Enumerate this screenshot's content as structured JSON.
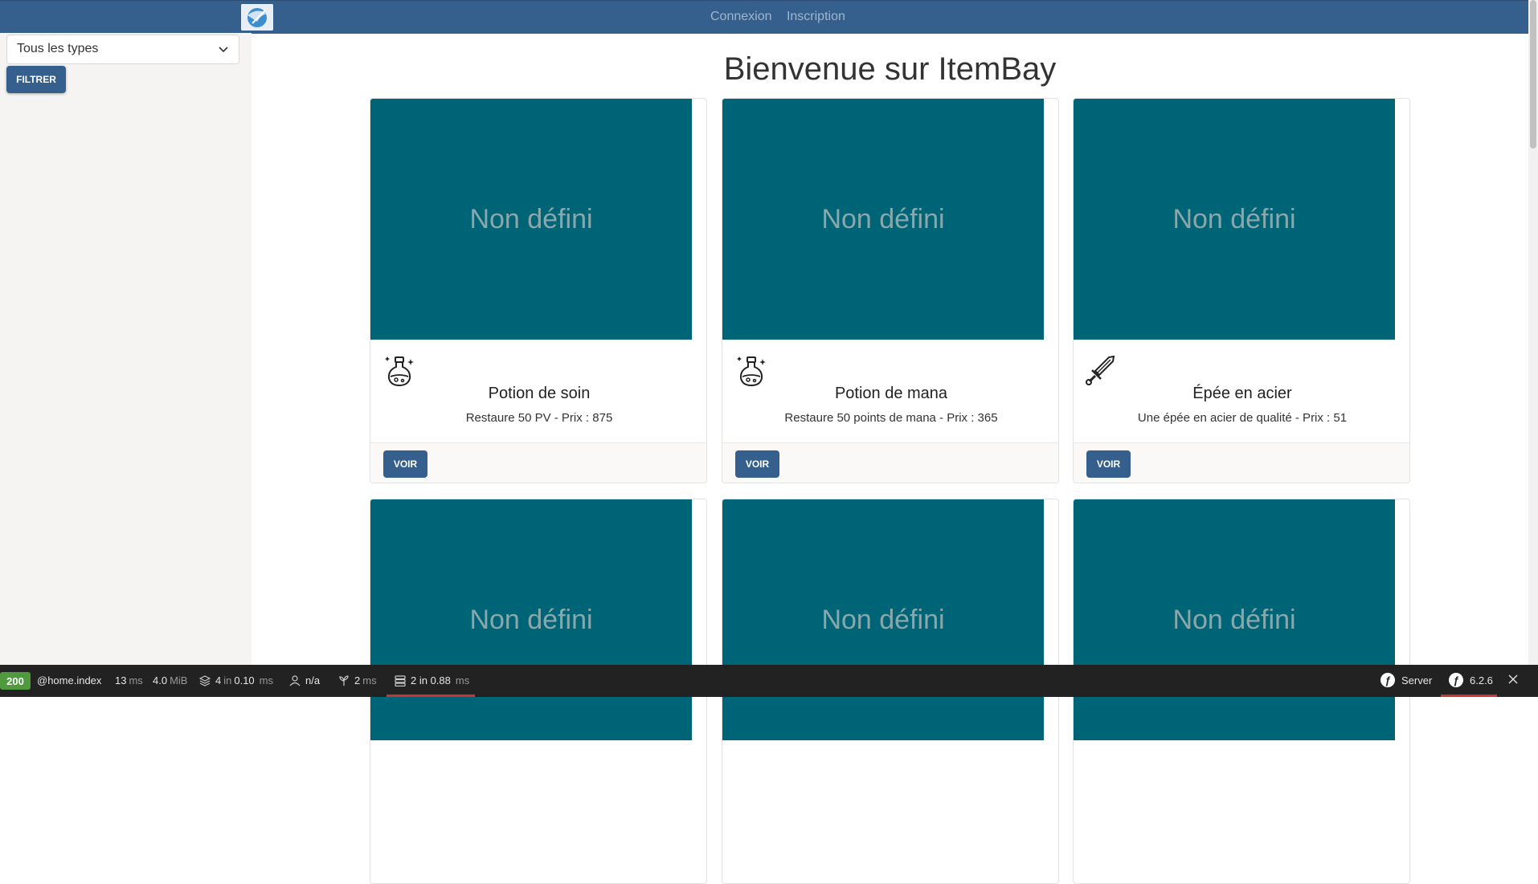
{
  "navbar": {
    "links": [
      "Connexion",
      "Inscription"
    ]
  },
  "sidebar": {
    "type_select": "Tous les types",
    "filter_label": "FILTRER"
  },
  "main": {
    "title": "Bienvenue sur ItemBay",
    "cards": [
      {
        "image_text": "Non défini",
        "icon": "potion-icon",
        "name": "Potion de soin",
        "desc": "Restaure 50 PV - Prix : 875",
        "button": "VOIR"
      },
      {
        "image_text": "Non défini",
        "icon": "potion-icon",
        "name": "Potion de mana",
        "desc": "Restaure 50 points de mana - Prix : 365",
        "button": "VOIR"
      },
      {
        "image_text": "Non défini",
        "icon": "sword-icon",
        "name": "Épée en acier",
        "desc": "Une épée en acier de qualité - Prix : 51",
        "button": "VOIR"
      },
      {
        "image_text": "Non défini"
      },
      {
        "image_text": "Non défini"
      },
      {
        "image_text": "Non défini"
      }
    ]
  },
  "toolbar": {
    "status": "200",
    "route": "@home.index",
    "time_value": "13",
    "time_unit": "ms",
    "memory_value": "4.0",
    "memory_unit": "MiB",
    "cache_a": "4",
    "cache_in": "in",
    "cache_b": "0.10",
    "cache_unit": "ms",
    "user": "n/a",
    "twig_value": "2",
    "twig_unit": "ms",
    "db_a": "2 in 0.88",
    "db_unit": "ms",
    "server_label": "Server",
    "version": "6.2.6"
  },
  "colors": {
    "navbar": "#355f8c",
    "card_image": "#006477",
    "button": "#355f8c",
    "status_ok": "#4f9a3c"
  }
}
